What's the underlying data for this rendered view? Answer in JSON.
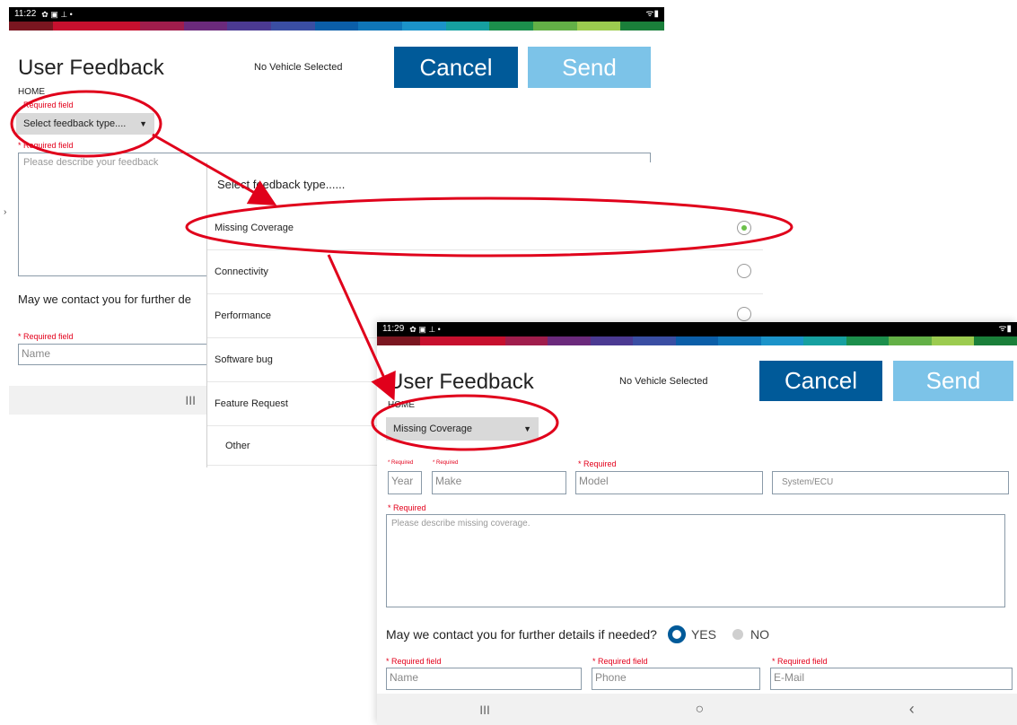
{
  "screen1": {
    "status": {
      "time": "11:22",
      "icons": "✿ ▣ ⊥ •",
      "right_icons": "ᯤ▮"
    },
    "title": "User Feedback",
    "vehicle": "No Vehicle Selected",
    "cancel_label": "Cancel",
    "send_label": "Send",
    "breadcrumb": "HOME",
    "required_label": "Required field",
    "required_label_star": "* Required field",
    "feedback_type_placeholder": "Select feedback type....",
    "description_placeholder": "Please describe your feedback",
    "contact_question": "May we contact you for further de",
    "name_required": "* Required field",
    "name_placeholder": "Name",
    "nav_recent": "III"
  },
  "popup": {
    "title": "Select feedback type......",
    "options": [
      {
        "label": "Missing Coverage"
      },
      {
        "label": "Connectivity"
      },
      {
        "label": "Performance"
      },
      {
        "label": "Software bug"
      },
      {
        "label": "Feature Request"
      },
      {
        "label": "Other"
      }
    ]
  },
  "screen2": {
    "status": {
      "time": "11:29",
      "icons": "✿ ▣ ⊥ •",
      "right_icons": "ᯤ▮"
    },
    "title": "User Feedback",
    "vehicle": "No Vehicle Selected",
    "cancel_label": "Cancel",
    "send_label": "Send",
    "breadcrumb": "HOME",
    "feedback_type_value": "Missing Coverage",
    "required_small": "* Required",
    "year_placeholder": "Year",
    "make_placeholder": "Make",
    "model_placeholder": "Model",
    "system_placeholder": "System/ECU",
    "description_placeholder": "Please describe missing coverage.",
    "contact_question": "May we contact you for further details if needed?",
    "yes_label": "YES",
    "no_label": "NO",
    "required_field": "* Required field",
    "name_placeholder": "Name",
    "phone_placeholder": "Phone",
    "email_placeholder": "E-Mail",
    "nav": {
      "recent": "III",
      "home": "○",
      "back": "‹"
    }
  },
  "colors": {
    "cancel": "#005a99",
    "send": "#7cc3e8",
    "required": "#e3001b",
    "annotation": "#e0001b",
    "radio_on": "#6cc04a",
    "strip": [
      "#7a1620",
      "#c7102e",
      "#c7102e",
      "#a01d4c",
      "#6b2a7c",
      "#4b3a92",
      "#3a4ea3",
      "#0b5ea8",
      "#0f76b8",
      "#1b93c9",
      "#16a0a0",
      "#1c8f4c",
      "#63b046",
      "#9ccb4f",
      "#1a7f3a"
    ]
  }
}
